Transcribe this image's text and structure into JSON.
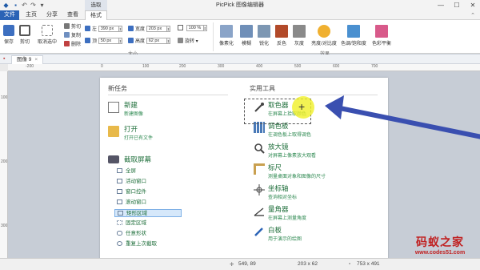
{
  "window": {
    "title": "PicPick 图像编辑器",
    "context_tab_header": "选取"
  },
  "menu": {
    "tabs": [
      "文件",
      "主页",
      "分享",
      "查看",
      "格式"
    ]
  },
  "ribbon": {
    "save": "保存",
    "crop": "剪切",
    "deselect": "取消选中",
    "cut": "剪切",
    "copy": "复制",
    "delete": "删除",
    "left_label": "左",
    "left_value": "390 px",
    "width_label": "宽度",
    "width_value": "203 px",
    "top_label": "顶",
    "top_value": "50 px",
    "height_label": "高度",
    "height_value": "62 px",
    "zoom_value": "100 %",
    "rotate_label": "旋转",
    "size_group": "大小",
    "effects_group": "效果",
    "effects": [
      {
        "label": "像素化",
        "color": "#8aa4c8"
      },
      {
        "label": "模糊",
        "color": "#6f8fb8"
      },
      {
        "label": "锐化",
        "color": "#7d97b3"
      },
      {
        "label": "反色",
        "color": "#b24a2a"
      },
      {
        "label": "灰度",
        "color": "#8a8a8a"
      },
      {
        "label": "亮度/对比度",
        "color": "#f0b030"
      },
      {
        "label": "色调/饱和度",
        "color": "#4a90d0"
      },
      {
        "label": "色彩平衡",
        "color": "#d85a8a"
      }
    ]
  },
  "document_tab": {
    "name": "图像 9"
  },
  "rulers": {
    "h_ticks": [
      "-200",
      "0",
      "100",
      "200",
      "300",
      "400",
      "500",
      "600",
      "700"
    ],
    "v_ticks": [
      "100",
      "200",
      "300"
    ]
  },
  "page": {
    "left_title": "新任务",
    "right_title": "实用工具",
    "tasks": [
      {
        "title": "新建",
        "sub": "新建图像"
      },
      {
        "title": "打开",
        "sub": "打开已有文件"
      }
    ],
    "capture_title": "截取屏幕",
    "capture_items": [
      "全屏",
      "活动窗口",
      "窗口控件",
      "滚动窗口",
      "矩形区域",
      "固定区域",
      "任意形状",
      "重复上次截取"
    ],
    "selected_capture_index": 4,
    "tools": [
      {
        "title": "取色器",
        "sub": "在屏幕上拾取颜色"
      },
      {
        "title": "调色板",
        "sub": "在调色板上取得调色"
      },
      {
        "title": "放大镜",
        "sub": "对屏幕上像素放大观看"
      },
      {
        "title": "标尺",
        "sub": "测量桌面对象和图像的尺寸"
      },
      {
        "title": "坐标轴",
        "sub": "查询相对坐标"
      },
      {
        "title": "量角器",
        "sub": "在屏幕上测量角度"
      },
      {
        "title": "白板",
        "sub": "用于演示的绘图"
      }
    ]
  },
  "status": {
    "cursor": "549, 89",
    "selection": "203 x 62",
    "image_size": "753 x 491"
  },
  "watermark": {
    "line1": "码蚁之家",
    "line2": "www.codes51.com"
  },
  "colors": {
    "accent": "#2b63b6",
    "arrow": "#3a4fb0",
    "highlight": "#f0f028"
  }
}
